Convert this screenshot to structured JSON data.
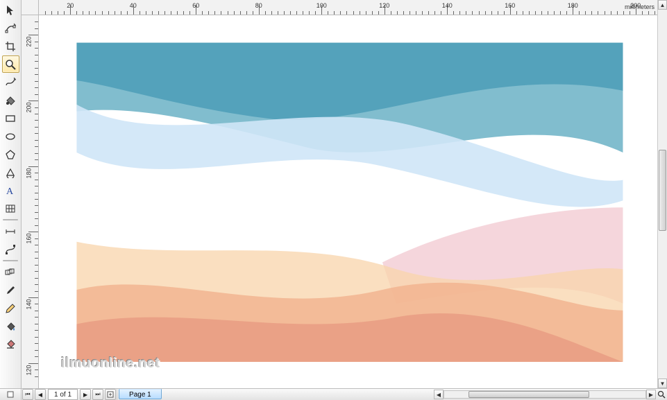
{
  "ruler": {
    "unit": "millimeters",
    "h_major": [
      20,
      40,
      60,
      80,
      100,
      120,
      140,
      160,
      180,
      200
    ],
    "v_major": [
      220,
      200,
      180,
      160,
      140,
      120
    ]
  },
  "toolbox": {
    "tools": [
      {
        "name": "pick-tool",
        "icon": "arrow"
      },
      {
        "name": "shape-tool",
        "icon": "nodeedit"
      },
      {
        "name": "crop-tool",
        "icon": "crop"
      },
      {
        "name": "zoom-tool",
        "icon": "zoom",
        "active": true
      },
      {
        "name": "freehand-tool",
        "icon": "freehand"
      },
      {
        "name": "smart-fill-tool",
        "icon": "smartfill"
      },
      {
        "name": "rectangle-tool",
        "icon": "rect"
      },
      {
        "name": "ellipse-tool",
        "icon": "ellipse"
      },
      {
        "name": "polygon-tool",
        "icon": "polygon"
      },
      {
        "name": "basic-shapes-tool",
        "icon": "basicshape"
      },
      {
        "name": "text-tool",
        "icon": "text"
      },
      {
        "name": "table-tool",
        "icon": "table"
      },
      {
        "name": "dimension-tool",
        "icon": "dimension"
      },
      {
        "name": "connector-tool",
        "icon": "connector"
      },
      {
        "name": "blend-tool",
        "icon": "blend"
      },
      {
        "name": "color-eyedropper-tool",
        "icon": "eyedrop"
      },
      {
        "name": "outline-pen-tool",
        "icon": "outlinepen"
      },
      {
        "name": "fill-tool",
        "icon": "fill"
      },
      {
        "name": "interactive-fill-tool",
        "icon": "intfill"
      }
    ]
  },
  "navigation": {
    "page_count_label": "1 of 1",
    "page_tab_label": "Page 1"
  },
  "watermark": "ilmuonline.net"
}
